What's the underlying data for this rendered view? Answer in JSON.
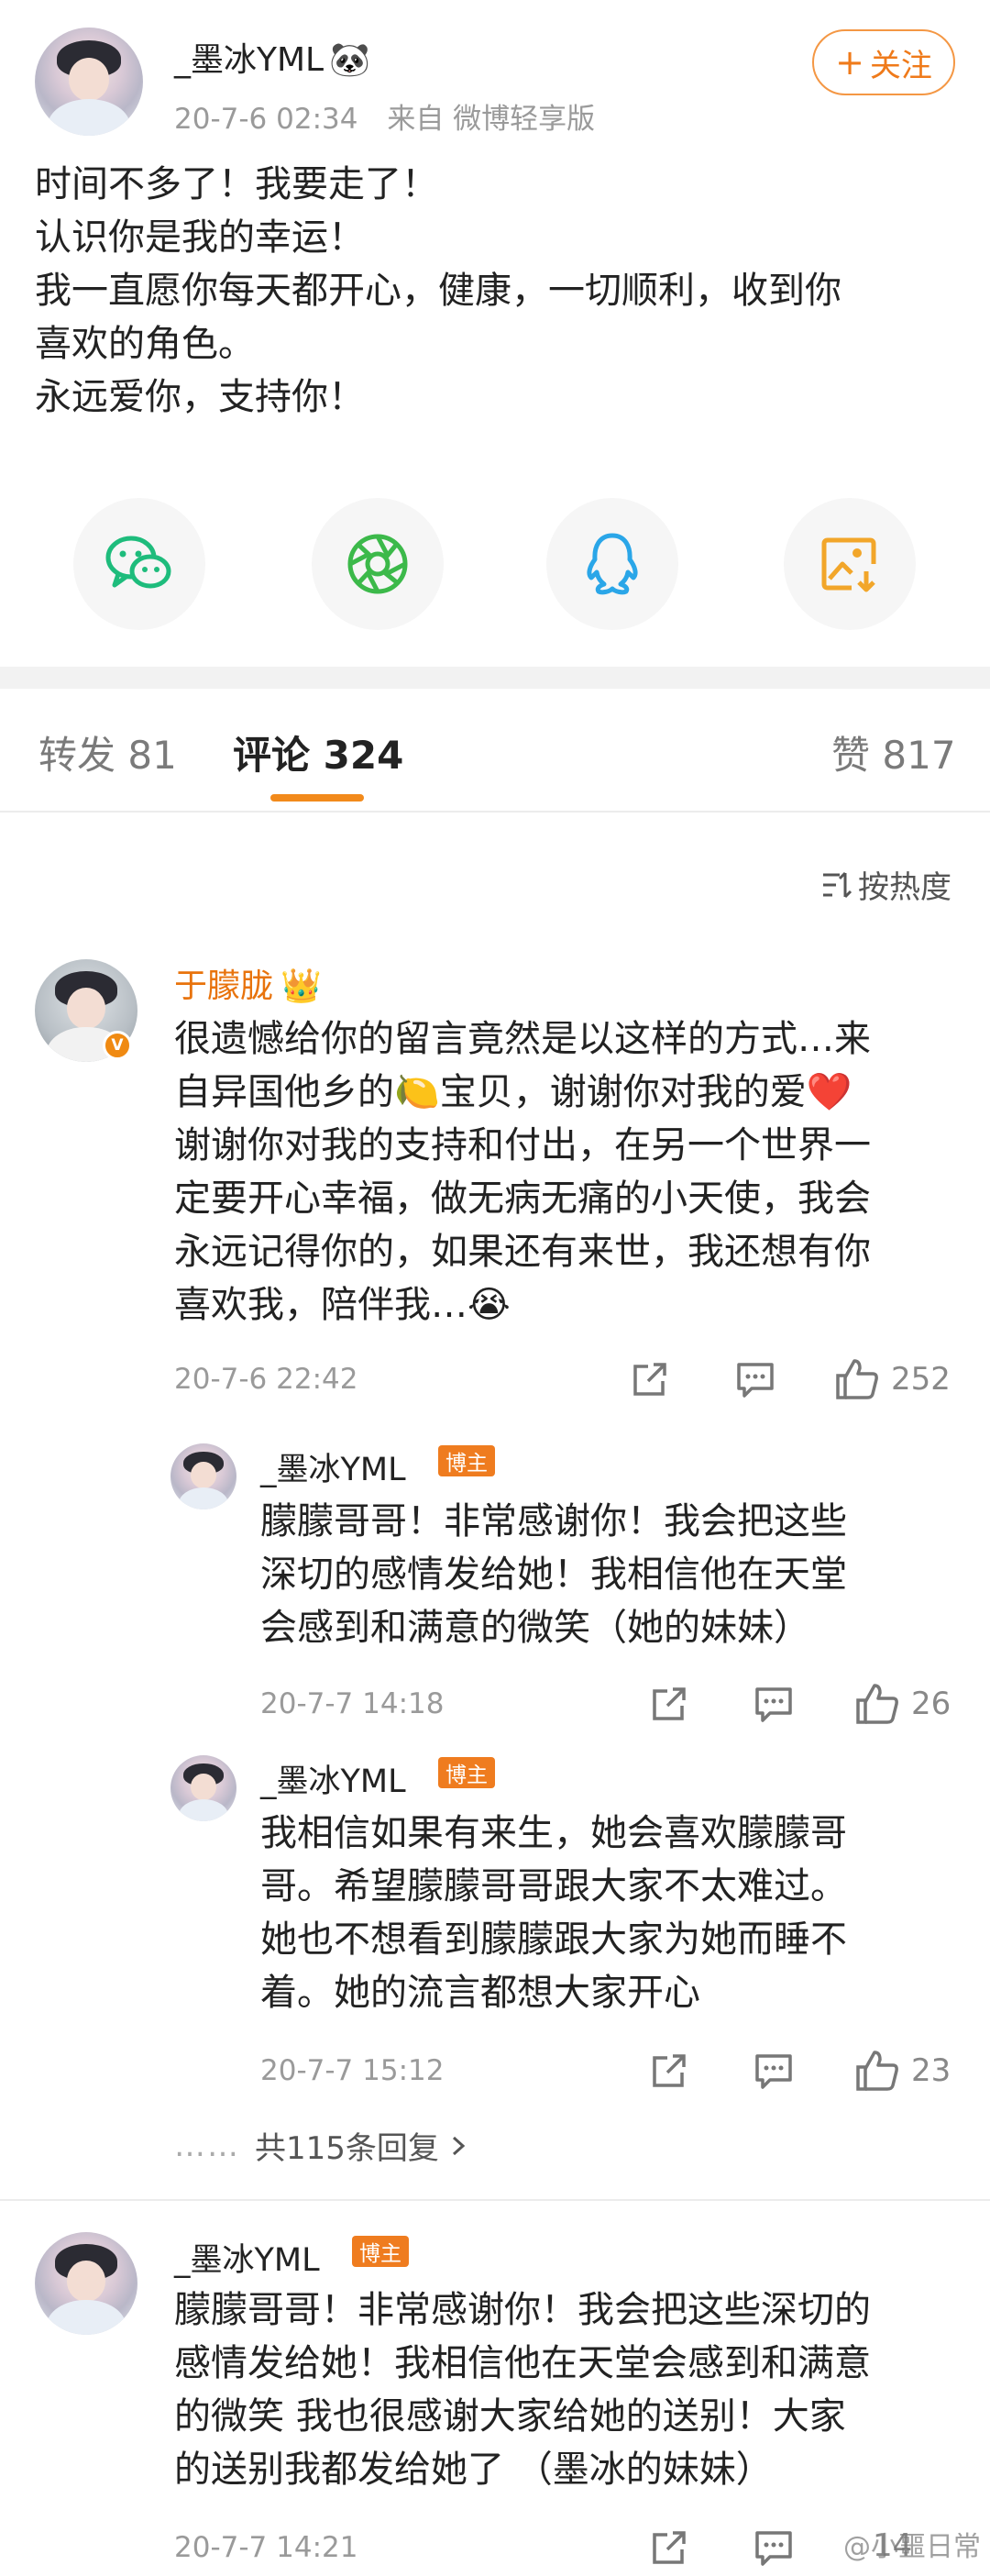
{
  "post": {
    "author": "_墨冰YML",
    "author_emoji": "🐼",
    "time": "20-7-6 02:34",
    "source": "来自 微博轻享版",
    "follow_label": "关注",
    "lines": [
      "时间不多了！我要走了！",
      "认识你是我的幸运！",
      "我一直愿你每天都开心，健康，一切顺利，收到你",
      "喜欢的角色。",
      "永远爱你，支持你！"
    ]
  },
  "share": {
    "icons": [
      "wechat-icon",
      "moments-icon",
      "qq-icon",
      "save-image-icon"
    ],
    "colors": {
      "wechat": "#1ebc7c",
      "moments": "#3cb94a",
      "qq": "#2aa6e8",
      "save": "#f2a62a"
    }
  },
  "tabs": [
    {
      "label": "转发",
      "count": "81"
    },
    {
      "label": "评论",
      "count": "324"
    },
    {
      "label": "赞",
      "count": "817"
    }
  ],
  "sort_label": "按热度",
  "comments": [
    {
      "author": "于朦胧",
      "crown": "👑",
      "lines": [
        "很遗憾给你的留言竟然是以这样的方式…来",
        "自异国他乡的🍋宝贝，谢谢你对我的爱❤️",
        "谢谢你对我的支持和付出，在另一个世界一",
        "定要开心幸福，做无病无痛的小天使，我会",
        "永远记得你的，如果还有来世，我还想有你",
        "喜欢我，陪伴我…😭"
      ],
      "time": "20-7-6 22:42",
      "likes": "252"
    },
    {
      "author": "_墨冰YML",
      "badge": "博主",
      "lines": [
        "朦朦哥哥！非常感谢你！我会把这些",
        "深切的感情发给她！我相信他在天堂",
        "会感到和满意的微笑（她的妹妹）"
      ],
      "time": "20-7-7 14:18",
      "likes": "26"
    },
    {
      "author": "_墨冰YML",
      "badge": "博主",
      "lines": [
        "我相信如果有来生，她会喜欢朦朦哥",
        "哥。希望朦朦哥哥跟大家不太难过。",
        "她也不想看到朦朦跟大家为她而睡不",
        "着。她的流言都想大家开心"
      ],
      "time": "20-7-7 15:12",
      "likes": "23"
    },
    {
      "author": "_墨冰YML",
      "badge": "博主",
      "lines": [
        "朦朦哥哥！非常感谢你！我会把这些深切的",
        "感情发给她！我相信他在天堂会感到和满意",
        "的微笑 我也很感谢大家给她的送别！大家",
        "的送别我都发给她了 （墨冰的妹妹）"
      ],
      "time": "20-7-7 14:21",
      "likes": "14"
    }
  ],
  "more_replies": {
    "dots": "……",
    "label": "共115条回复"
  },
  "watermark": "@小噩日常"
}
